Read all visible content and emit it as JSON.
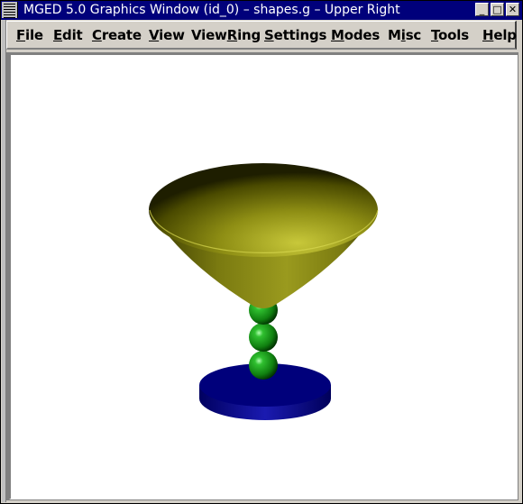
{
  "window": {
    "title": "MGED 5.0 Graphics Window (id_0) – shapes.g – Upper Right",
    "controls": [
      {
        "name": "minimize",
        "glyph": "_"
      },
      {
        "name": "maximize",
        "glyph": "□"
      },
      {
        "name": "close",
        "glyph": "✕"
      }
    ]
  },
  "menubar": {
    "items": [
      {
        "label": "File",
        "mnemonic": "F",
        "rest": "ile"
      },
      {
        "label": "Edit",
        "mnemonic": "E",
        "rest": "dit"
      },
      {
        "label": "Create",
        "mnemonic": "C",
        "rest": "reate"
      },
      {
        "label": "View",
        "mnemonic": "V",
        "rest": "iew"
      },
      {
        "label": "ViewRing",
        "pre": "View",
        "mnemonic": "R",
        "rest": "ing"
      },
      {
        "label": "Settings",
        "mnemonic": "S",
        "rest": "ettings"
      },
      {
        "label": "Modes",
        "mnemonic": "M",
        "rest": "odes"
      },
      {
        "label": "Misc",
        "pre": "M",
        "mnemonic": "i",
        "rest": "sc"
      },
      {
        "label": "Tools",
        "mnemonic": "T",
        "rest": "ools"
      },
      {
        "label": "Help",
        "mnemonic": "H",
        "rest": "elp"
      }
    ]
  },
  "scene": {
    "objects": [
      {
        "name": "cone-bowl",
        "color": "#b0b020"
      },
      {
        "name": "sphere-top",
        "color": "#20a020"
      },
      {
        "name": "sphere-middle",
        "color": "#20a020"
      },
      {
        "name": "sphere-bottom",
        "color": "#20a020"
      },
      {
        "name": "base-disc",
        "color": "#00007b"
      }
    ],
    "background": "#ffffff"
  }
}
